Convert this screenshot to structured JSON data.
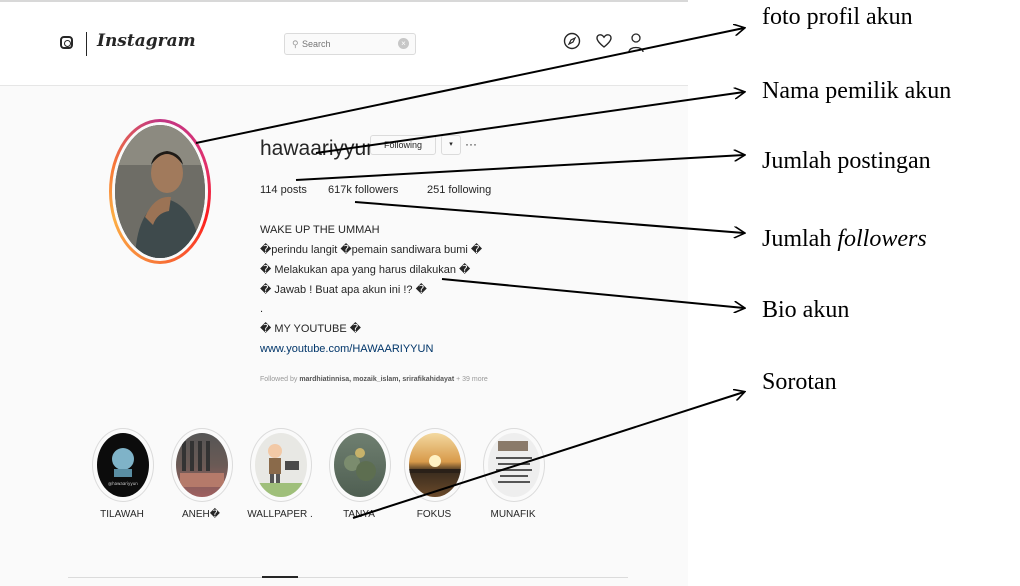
{
  "topbar": {
    "brand": "Instagram",
    "search_placeholder": "Search",
    "search_clear": "×"
  },
  "profile": {
    "username": "hawaariyyun",
    "following_button": "Following",
    "dropdown_icon": "▾",
    "more_icon": "···",
    "stats": {
      "posts": "114 posts",
      "followers": "617k followers",
      "following": "251 following"
    },
    "bio": [
      "WAKE UP THE UMMAH",
      "�perindu langit �pemain sandiwara bumi �",
      "� Melakukan apa yang harus dilakukan �",
      "� Jawab ! Buat apa akun ini !? �",
      ".",
      "� MY YOUTUBE �"
    ],
    "bio_link": "www.youtube.com/HAWAARIYYUN",
    "followed_by_prefix": "Followed by",
    "followed_by_names": "mardhiatinnisa, mozaik_islam, srirafikahidayat",
    "followed_by_more": "+ 39 more"
  },
  "highlights": [
    {
      "label": "TILAWAH"
    },
    {
      "label": "ANEH�"
    },
    {
      "label": "WALLPAPER ."
    },
    {
      "label": "TANYA"
    },
    {
      "label": "FOKUS"
    },
    {
      "label": "MUNAFIK"
    }
  ],
  "annotations": {
    "profile_photo": "foto profil akun",
    "owner_name": "Nama pemilik akun",
    "post_count": "Jumlah postingan",
    "followers_prefix": "Jumlah ",
    "followers_italic": "followers",
    "bio": "Bio akun",
    "highlights": "Sorotan"
  },
  "colors": {
    "background": "#fafafa",
    "text": "#262626",
    "link": "#003569",
    "muted": "#999999",
    "border": "#dbdbdb"
  },
  "icons": [
    "instagram-glyph-icon",
    "search-icon",
    "clear-icon",
    "compass-icon",
    "heart-icon",
    "user-icon",
    "chevron-down-icon",
    "more-icon"
  ]
}
